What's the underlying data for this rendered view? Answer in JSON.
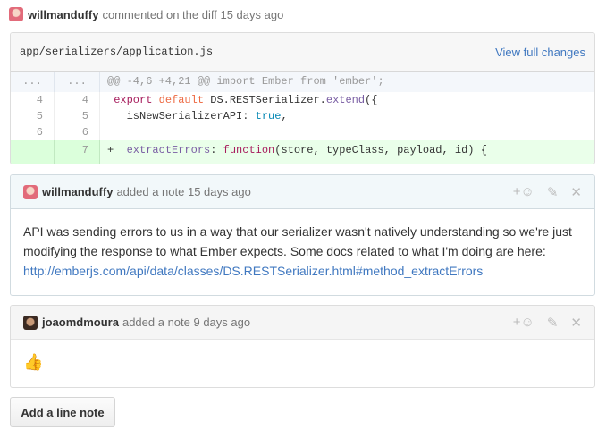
{
  "header": {
    "author": "willmanduffy",
    "text": "commented on the diff 15 days ago"
  },
  "diff": {
    "filename": "app/serializers/application.js",
    "view_full": "View full changes",
    "hunk": {
      "old": "...",
      "new": "...",
      "text": "@@ -4,6 +4,21 @@ import Ember from 'ember';"
    },
    "lines": [
      {
        "old": "4",
        "new": "4",
        "parts": [
          " ",
          "export",
          " ",
          "default",
          " DS.RESTSerializer.",
          "extend",
          "({"
        ]
      },
      {
        "old": "5",
        "new": "5",
        "parts": [
          "   isNewSerializerAPI: ",
          "true",
          ","
        ]
      },
      {
        "old": "6",
        "new": "6",
        "parts": [
          ""
        ]
      },
      {
        "old": "",
        "new": "7",
        "parts": [
          "+  ",
          "extractErrors",
          ": ",
          "function",
          "(store, typeClass, payload, id) {"
        ]
      }
    ]
  },
  "notes": [
    {
      "author": "willmanduffy",
      "meta": "added a note 15 days ago",
      "body": "API was sending errors to us in a way that our serializer wasn't natively understanding so we're just modifying the response to what Ember expects. Some docs related to what I'm doing are here:",
      "link": "http://emberjs.com/api/data/classes/DS.RESTSerializer.html#method_extractErrors",
      "actions": {
        "react": "+☺",
        "edit": "✎",
        "delete": "✕"
      }
    },
    {
      "author": "joaomdmoura",
      "meta": "added a note 9 days ago",
      "body": "👍",
      "actions": {
        "react": "+☺",
        "edit": "✎",
        "delete": "✕"
      }
    }
  ],
  "button": {
    "add_line_note": "Add a line note"
  }
}
